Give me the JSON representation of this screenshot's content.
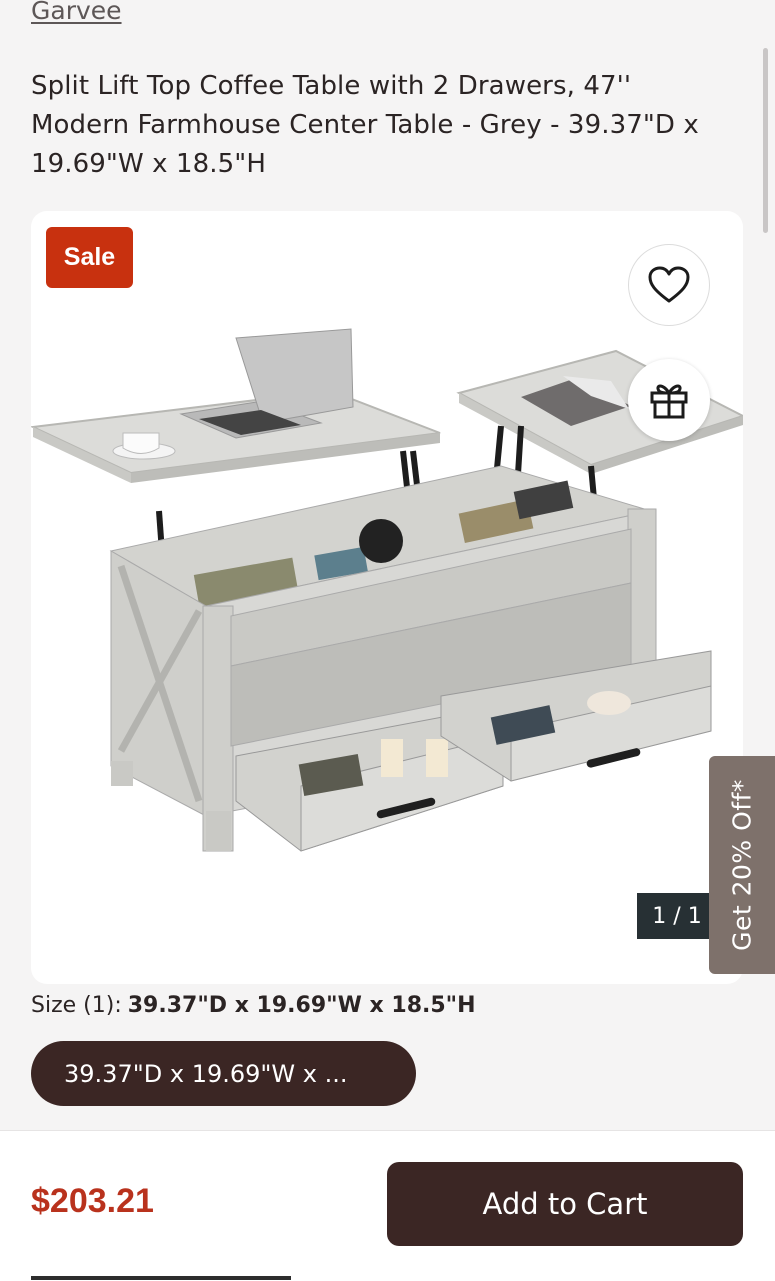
{
  "header": {
    "brand": "Garvee",
    "title": "Split Lift Top Coffee Table with 2 Drawers, 47'' Modern Farmhouse Center Table - Grey - 39.37\"D x 19.69\"W x 18.5\"H"
  },
  "gallery": {
    "sale_badge": "Sale",
    "wishlist_icon": "heart-icon",
    "gift_icon": "gift-icon",
    "counter": "1 / 1",
    "promo_tab": "Get 20% Off*"
  },
  "size": {
    "label": "Size (1):",
    "selected_value": "39.37\"D x 19.69\"W x 18.5\"H",
    "option_pill": "39.37\"D x 19.69\"W x ..."
  },
  "purchase": {
    "price": "$203.21",
    "add_to_cart": "Add to Cart"
  },
  "colors": {
    "sale": "#c8310f",
    "price": "#b9321d",
    "primary_button": "#3b2624",
    "promo_tab": "#7e716b"
  }
}
